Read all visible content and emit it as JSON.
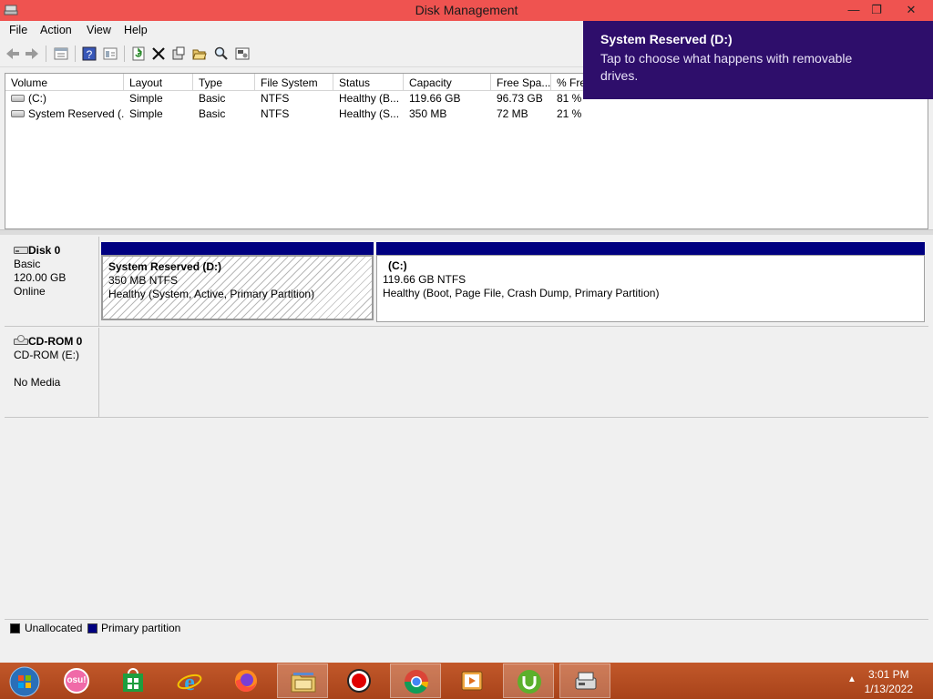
{
  "window": {
    "title": "Disk Management"
  },
  "menu": [
    "File",
    "Action",
    "View",
    "Help"
  ],
  "toolbar": {
    "buttons": [
      "back-icon",
      "forward-icon",
      "up-pane-icon",
      "help-icon",
      "properties-icon",
      "refresh-icon",
      "delete-icon",
      "settings-icon",
      "open-folder-icon",
      "search-icon",
      "disk-props-icon"
    ]
  },
  "volume_list": {
    "columns": [
      "Volume",
      "Layout",
      "Type",
      "File System",
      "Status",
      "Capacity",
      "Free Spa...",
      "% Fre"
    ],
    "rows": [
      [
        "(C:)",
        "Simple",
        "Basic",
        "NTFS",
        "Healthy (B...",
        "119.66 GB",
        "96.73 GB",
        "81 %"
      ],
      [
        "System Reserved (...",
        "Simple",
        "Basic",
        "NTFS",
        "Healthy (S...",
        "350 MB",
        "72 MB",
        "21 %"
      ]
    ]
  },
  "disks": [
    {
      "name": "Disk 0",
      "type": "Basic",
      "size": "120.00 GB",
      "status": "Online",
      "partitions": [
        {
          "title": "System Reserved  (D:)",
          "size": "350 MB NTFS",
          "status": "Healthy (System, Active, Primary Partition)"
        },
        {
          "title": "(C:)",
          "size": "119.66 GB NTFS",
          "status": "Healthy (Boot, Page File, Crash Dump, Primary Partition)"
        }
      ]
    },
    {
      "name": "CD-ROM 0",
      "type": "CD-ROM (E:)",
      "media": "No Media"
    }
  ],
  "legend": [
    {
      "label": "Unallocated",
      "color": "#000000"
    },
    {
      "label": "Primary partition",
      "color": "#000080"
    }
  ],
  "toast": {
    "title": "System Reserved (D:)",
    "message": "Tap to choose what happens with removable drives."
  },
  "taskbar": {
    "items": [
      "start-orb-icon",
      "osu-icon",
      "store-icon",
      "internet-explorer-icon",
      "firefox-icon",
      "file-explorer-icon",
      "obs-icon",
      "chrome-icon",
      "media-player-icon",
      "utorrent-icon",
      "disk-management-icon"
    ],
    "osu_label": "osu!",
    "time": "3:01 PM",
    "date": "1/13/2022"
  },
  "colors": {
    "titlebar": "#ef5350",
    "toast": "#2e0e6b",
    "primary_partition": "#000080",
    "taskbar": "#b24a1a"
  }
}
